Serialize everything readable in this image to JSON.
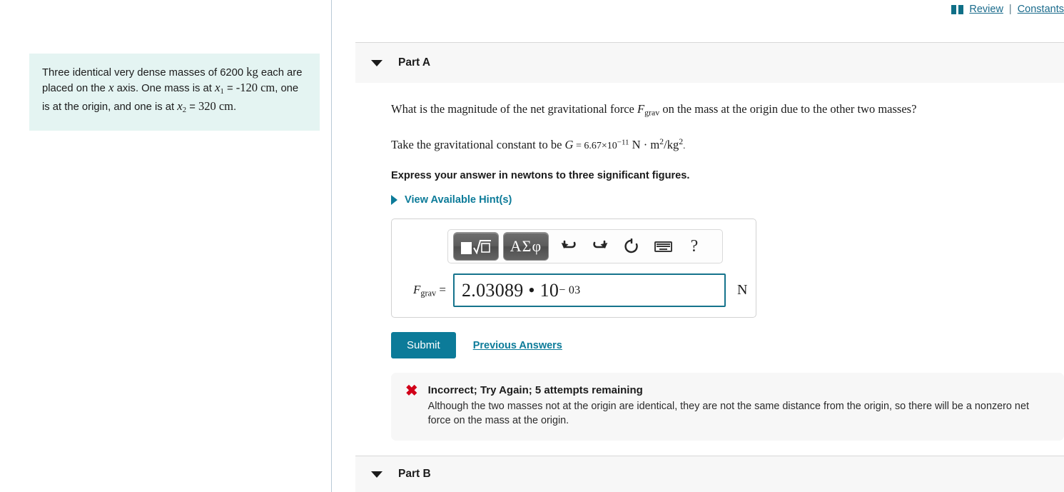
{
  "top_links": {
    "book_icon": "book-icon",
    "review_label": " Review",
    "separator": "|",
    "constants_label": "Constants"
  },
  "problem": {
    "text_1": "Three identical very dense masses of 6200 ",
    "unit_kg": "kg",
    "text_2": " each are placed on the ",
    "var_x": "x",
    "text_3": " axis. One mass is at ",
    "var_x1": "x",
    "sub_1": "1",
    "eq_1": " = ",
    "val_1": "-120 cm",
    "text_4": ", one is at the origin, and one is at ",
    "var_x2": "x",
    "sub_2": "2",
    "eq_2": " = ",
    "val_2": "320 cm",
    "text_5": "."
  },
  "part_a": {
    "label": "Part A",
    "caret": "caret-down-icon",
    "question_pre": "What is the magnitude of the net gravitational force ",
    "question_var": "F",
    "question_sub": "grav",
    "question_post": " on the mass at the origin due to the other two masses?",
    "constant_pre": "Take the gravitational constant to be ",
    "constant_var": "G",
    "constant_eq": " = 6.67×10",
    "constant_exp": "−11",
    "constant_units_n": " N",
    "constant_dot": " · ",
    "constant_m": "m",
    "constant_m_sup": "2",
    "constant_slash": "/",
    "constant_kg": "kg",
    "constant_kg_sup": "2",
    "constant_period": ".",
    "instruction": "Express your answer in newtons to three significant figures.",
    "hint_label": "View Available Hint(s)",
    "hint_caret": "caret-right-icon"
  },
  "toolbar": {
    "template_button": "math-template-button",
    "greek_button": "ΑΣφ",
    "undo_icon": "undo-arrow-icon",
    "redo_icon": "redo-arrow-icon",
    "reset_icon": "reset-circle-icon",
    "keyboard_icon": "keyboard-icon",
    "help_label": "?"
  },
  "answer": {
    "label_var": "F",
    "label_sub": "grav",
    "label_eq": " =",
    "value_mantissa": "2.03089 • 10",
    "value_exponent": "− 03",
    "unit": "N"
  },
  "actions": {
    "submit_label": "Submit",
    "previous_answers_label": "Previous Answers"
  },
  "feedback": {
    "icon": "error-x-icon",
    "title": "Incorrect; Try Again; 5 attempts remaining",
    "body": "Although the two masses not at the origin are identical, they are not the same distance from the origin, so there will be a nonzero net force on the mass at the origin."
  },
  "part_b": {
    "label": "Part B",
    "caret": "caret-down-icon"
  },
  "colors": {
    "accent_teal": "#0c7b99",
    "link_blue": "#1a6b8c",
    "problem_bg": "#e4f4f2",
    "error_red": "#d10019",
    "panel_gray": "#f7f7f7"
  }
}
